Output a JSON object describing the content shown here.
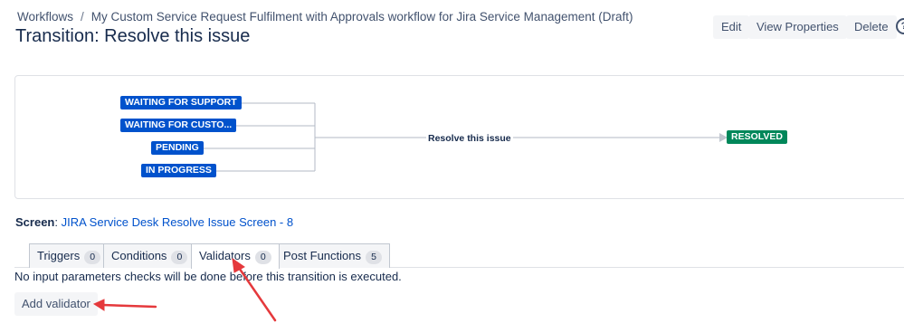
{
  "breadcrumb": {
    "items": [
      "Workflows",
      "My Custom Service Request Fulfilment with Approvals workflow for Jira Service Management (Draft)"
    ],
    "separator": "/"
  },
  "page_title": "Transition: Resolve this issue",
  "actions": {
    "edit": "Edit",
    "view_properties": "View Properties",
    "delete": "Delete",
    "help_icon": "?"
  },
  "diagram": {
    "source_statuses": [
      "WAITING FOR SUPPORT",
      "WAITING FOR CUSTO...",
      "PENDING",
      "IN PROGRESS"
    ],
    "transition_label": "Resolve this issue",
    "target_status": "RESOLVED",
    "colors": {
      "status_blue": "#0052cc",
      "status_green": "#00875a"
    }
  },
  "screen": {
    "label": "Screen",
    "link": "JIRA Service Desk Resolve Issue Screen - 8"
  },
  "tabs": [
    {
      "label": "Triggers",
      "count": "0"
    },
    {
      "label": "Conditions",
      "count": "0"
    },
    {
      "label": "Validators",
      "count": "0",
      "active": true
    },
    {
      "label": "Post Functions",
      "count": "5"
    }
  ],
  "info_text": "No input parameters checks will be done before this transition is executed.",
  "add_validator_label": "Add validator",
  "annotation_color": "#e5393c"
}
